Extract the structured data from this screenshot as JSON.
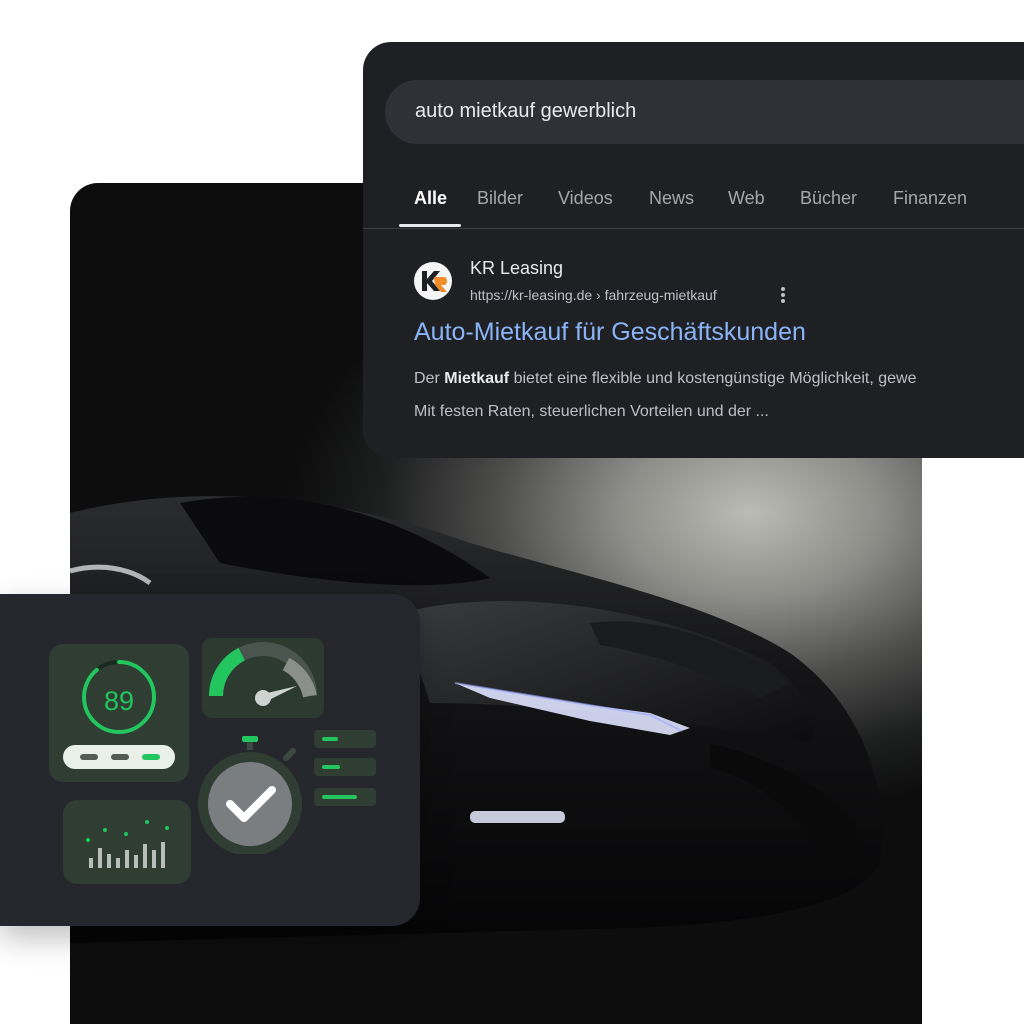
{
  "search": {
    "query": "auto mietkauf gewerblich",
    "tabs": [
      {
        "label": "Alle",
        "active": true
      },
      {
        "label": "Bilder",
        "active": false
      },
      {
        "label": "Videos",
        "active": false
      },
      {
        "label": "News",
        "active": false
      },
      {
        "label": "Web",
        "active": false
      },
      {
        "label": "Bücher",
        "active": false
      },
      {
        "label": "Finanzen",
        "active": false
      }
    ]
  },
  "result": {
    "site_name": "KR Leasing",
    "url": "https://kr-leasing.de › fahrzeug-mietkauf",
    "title": "Auto-Mietkauf für Geschäftskunden",
    "snippet_line1_pre": "Der ",
    "snippet_line1_bold": "Mietkauf",
    "snippet_line1_post": " bietet eine flexible und kostengünstige Möglichkeit, gewe",
    "snippet_line2": "Mit festen Raten, steuerlichen Vorteilen und der ...",
    "favicon_letters": "KR"
  },
  "dashboard": {
    "score": "89",
    "score_fraction": 0.89,
    "accent": "#22c55e",
    "gauge_level": 0.35,
    "mini_bars": [
      0.35,
      0.4,
      0.75
    ]
  },
  "colors": {
    "link": "#8ab4f8",
    "panel": "#1f2024",
    "search_bar": "#2f3137"
  }
}
